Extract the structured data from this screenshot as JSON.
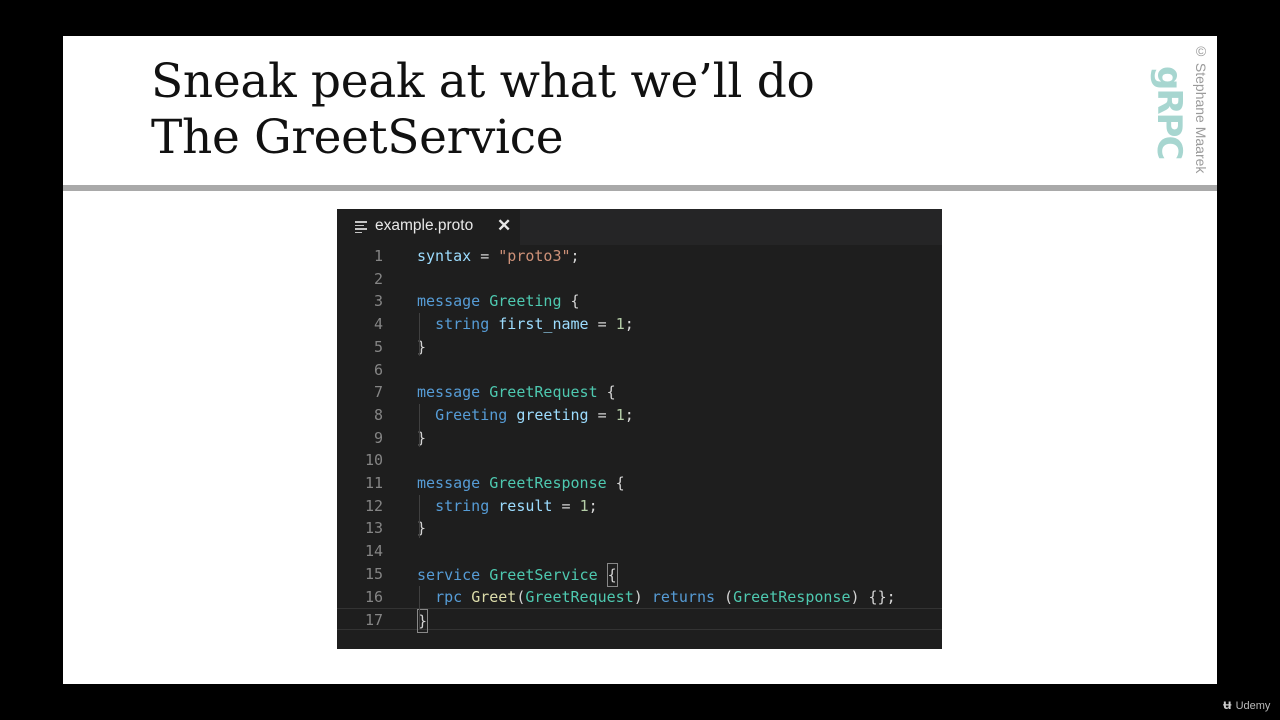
{
  "slide": {
    "title_line1": "Sneak peak at what we’ll do",
    "title_line2": "The GreetService",
    "copyright": "© Stephane Maarek",
    "logo_text": "gRPC"
  },
  "editor": {
    "tab_label": "example.proto",
    "tab_close": "✕",
    "lines": [
      {
        "n": "1",
        "tokens": [
          {
            "t": "syntax",
            "c": "var"
          },
          {
            "t": " = ",
            "c": "pun"
          },
          {
            "t": "\"proto3\"",
            "c": "str"
          },
          {
            "t": ";",
            "c": "pun"
          }
        ]
      },
      {
        "n": "2",
        "tokens": []
      },
      {
        "n": "3",
        "tokens": [
          {
            "t": "message",
            "c": "kw"
          },
          {
            "t": " ",
            "c": "pun"
          },
          {
            "t": "Greeting",
            "c": "ty"
          },
          {
            "t": " {",
            "c": "pun"
          }
        ]
      },
      {
        "n": "4",
        "tokens": [
          {
            "t": "  ",
            "c": "pun"
          },
          {
            "t": "string",
            "c": "kw"
          },
          {
            "t": " ",
            "c": "pun"
          },
          {
            "t": "first_name",
            "c": "var"
          },
          {
            "t": " = ",
            "c": "pun"
          },
          {
            "t": "1",
            "c": "num"
          },
          {
            "t": ";",
            "c": "pun"
          }
        ]
      },
      {
        "n": "5",
        "tokens": [
          {
            "t": "}",
            "c": "pun"
          }
        ]
      },
      {
        "n": "6",
        "tokens": []
      },
      {
        "n": "7",
        "tokens": [
          {
            "t": "message",
            "c": "kw"
          },
          {
            "t": " ",
            "c": "pun"
          },
          {
            "t": "GreetRequest",
            "c": "ty"
          },
          {
            "t": " {",
            "c": "pun"
          }
        ]
      },
      {
        "n": "8",
        "tokens": [
          {
            "t": "  ",
            "c": "pun"
          },
          {
            "t": "Greeting",
            "c": "kw"
          },
          {
            "t": " ",
            "c": "pun"
          },
          {
            "t": "greeting",
            "c": "var"
          },
          {
            "t": " = ",
            "c": "pun"
          },
          {
            "t": "1",
            "c": "num"
          },
          {
            "t": ";",
            "c": "pun"
          }
        ]
      },
      {
        "n": "9",
        "tokens": [
          {
            "t": "}",
            "c": "pun"
          }
        ]
      },
      {
        "n": "10",
        "tokens": []
      },
      {
        "n": "11",
        "tokens": [
          {
            "t": "message",
            "c": "kw"
          },
          {
            "t": " ",
            "c": "pun"
          },
          {
            "t": "GreetResponse",
            "c": "ty"
          },
          {
            "t": " {",
            "c": "pun"
          }
        ]
      },
      {
        "n": "12",
        "tokens": [
          {
            "t": "  ",
            "c": "pun"
          },
          {
            "t": "string",
            "c": "kw"
          },
          {
            "t": " ",
            "c": "pun"
          },
          {
            "t": "result",
            "c": "var"
          },
          {
            "t": " = ",
            "c": "pun"
          },
          {
            "t": "1",
            "c": "num"
          },
          {
            "t": ";",
            "c": "pun"
          }
        ]
      },
      {
        "n": "13",
        "tokens": [
          {
            "t": "}",
            "c": "pun"
          }
        ]
      },
      {
        "n": "14",
        "tokens": []
      },
      {
        "n": "15",
        "tokens": [
          {
            "t": "service",
            "c": "kw"
          },
          {
            "t": " ",
            "c": "pun"
          },
          {
            "t": "GreetService",
            "c": "ty"
          },
          {
            "t": " ",
            "c": "pun"
          },
          {
            "t": "{",
            "c": "pun",
            "box": true
          }
        ]
      },
      {
        "n": "16",
        "tokens": [
          {
            "t": "  ",
            "c": "pun"
          },
          {
            "t": "rpc",
            "c": "kw"
          },
          {
            "t": " ",
            "c": "pun"
          },
          {
            "t": "Greet",
            "c": "fn"
          },
          {
            "t": "(",
            "c": "pun"
          },
          {
            "t": "GreetRequest",
            "c": "ty"
          },
          {
            "t": ") ",
            "c": "pun"
          },
          {
            "t": "returns",
            "c": "kw"
          },
          {
            "t": " (",
            "c": "pun"
          },
          {
            "t": "GreetResponse",
            "c": "ty"
          },
          {
            "t": ") {};",
            "c": "pun"
          }
        ]
      },
      {
        "n": "17",
        "tokens": [
          {
            "t": "}",
            "c": "pun",
            "box": true
          }
        ],
        "current": true
      }
    ]
  },
  "colors": {
    "keyword": "#569cd6",
    "type": "#4ec9b0",
    "string": "#ce9178",
    "number": "#b5cea8",
    "variable": "#9cdcfe",
    "function": "#dcdcaa",
    "editor_bg": "#1e1e1e",
    "logo": "#a7d6d0"
  },
  "watermark": {
    "udemy_label": "Udemy"
  }
}
